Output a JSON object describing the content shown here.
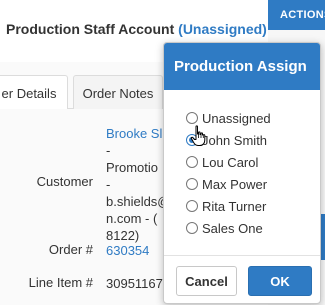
{
  "header": {
    "account_label": "Production Staff Account",
    "account_status": "(Unassigned)",
    "actions_label": "ACTIONS"
  },
  "tabs": [
    {
      "label": "Order Details",
      "visible_label": "er Details"
    },
    {
      "label": "Order Notes",
      "visible_label": "Order Notes"
    }
  ],
  "details": {
    "customer_label": "Customer",
    "customer_name": "Brooke Sl",
    "customer_lines": [
      "-",
      "Promotio",
      "-",
      "b.shields@",
      "n.com - (",
      "8122)"
    ],
    "order_label": "Order #",
    "order_value": "630354",
    "line_item_label": "Line Item #",
    "line_item_value": "30951167"
  },
  "modal": {
    "title": "Production Assign",
    "options": [
      "Unassigned",
      "John Smith",
      "Lou Carol",
      "Max Power",
      "Rita Turner",
      "Sales One"
    ],
    "selected": "John Smith",
    "cancel_label": "Cancel",
    "ok_label": "OK"
  },
  "colors": {
    "accent": "#2f7bc4"
  }
}
